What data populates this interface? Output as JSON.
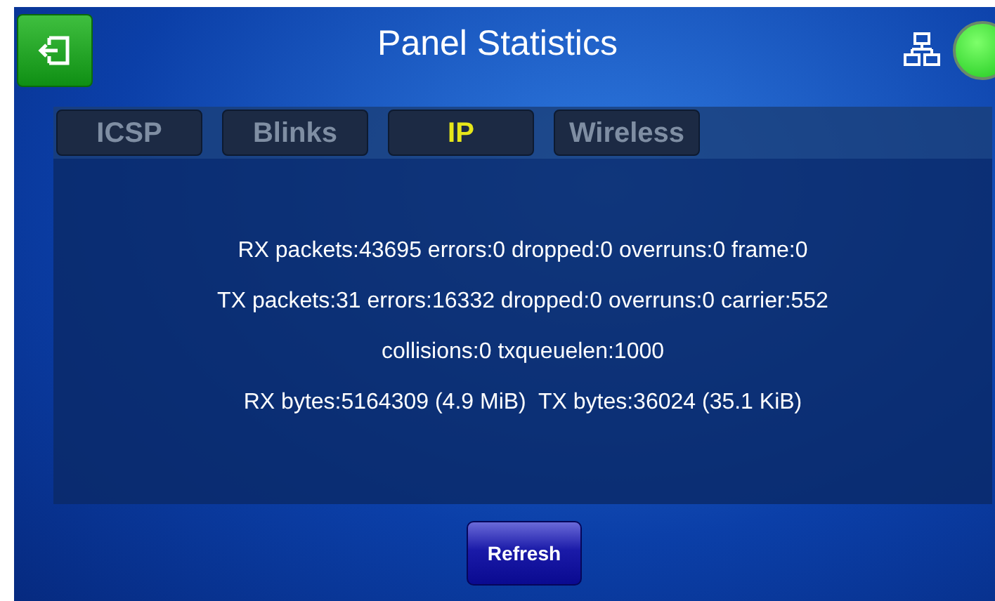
{
  "header": {
    "title": "Panel Statistics",
    "connected": true
  },
  "tabs": [
    {
      "label": "ICSP",
      "selected": false
    },
    {
      "label": "Blinks",
      "selected": false
    },
    {
      "label": "IP",
      "selected": true
    },
    {
      "label": "Wireless",
      "selected": false
    }
  ],
  "stats_lines": [
    "RX packets:43695 errors:0 dropped:0 overruns:0 frame:0",
    "TX packets:31 errors:16332 dropped:0 overruns:0 carrier:552",
    "collisions:0 txqueuelen:1000",
    "RX bytes:5164309 (4.9 MiB)  TX bytes:36024 (35.1 KiB)"
  ],
  "refresh_button": {
    "label": "Refresh"
  }
}
